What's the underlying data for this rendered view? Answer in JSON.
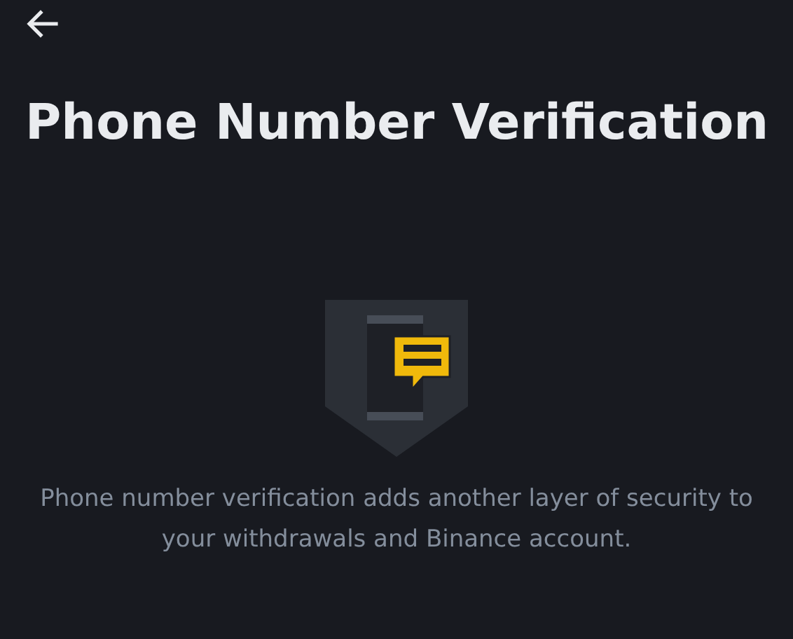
{
  "title": "Phone Number Verification",
  "description": "Phone number verification adds another layer of security to your withdrawals and Binance account."
}
